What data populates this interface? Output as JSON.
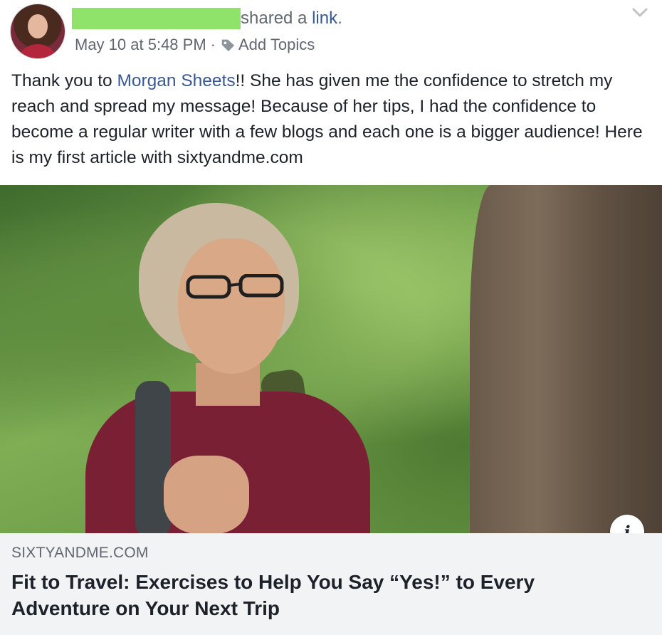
{
  "header": {
    "action_text": "shared a ",
    "action_link": "link",
    "action_suffix": ".",
    "timestamp": "May 10 at 5:48 PM",
    "separator": "·",
    "add_topics": "Add Topics",
    "tag_icon": "tag-icon",
    "options_icon": "chevron-down-icon"
  },
  "post": {
    "text_before_mention": "Thank you to ",
    "mention": "Morgan Sheets",
    "text_after_mention": "!! She has given me the confidence to stretch my reach and spread my message! Because of her tips, I had the confidence to become a regular writer with a few blogs and each one is a bigger audience! Here is my first article with sixtyandme.com"
  },
  "link_preview": {
    "info_icon": "i",
    "domain": "SIXTYANDME.COM",
    "title": "Fit to Travel: Exercises to Help You Say “Yes!” to Every Adventure on Your Next Trip"
  },
  "colors": {
    "link": "#385898",
    "meta_text": "#616770",
    "card_bg": "#f2f3f5",
    "redaction": "#8fe26a"
  }
}
